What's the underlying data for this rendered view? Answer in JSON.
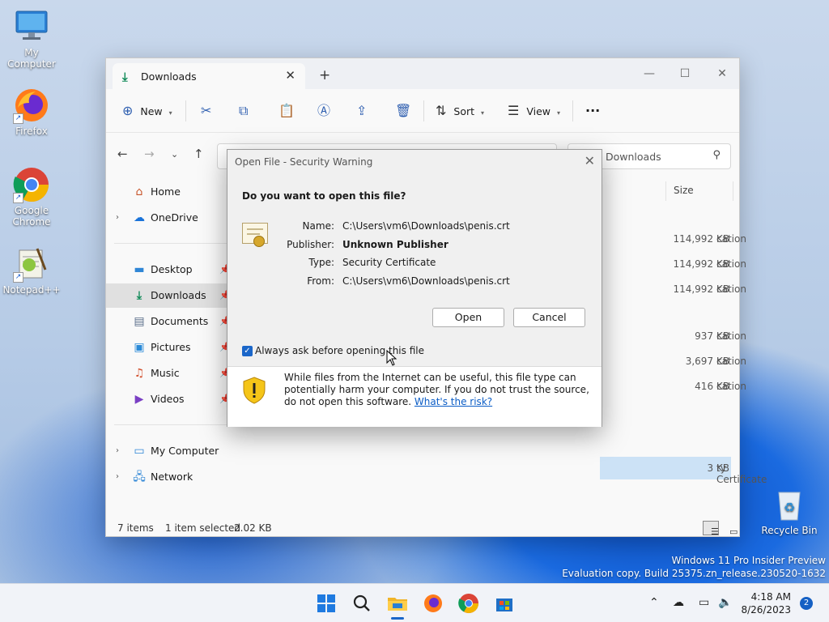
{
  "desktop": {
    "icons": [
      {
        "label": "My Computer"
      },
      {
        "label": "Firefox"
      },
      {
        "label": "Google Chrome"
      },
      {
        "label": "Notepad++"
      },
      {
        "label": "Recycle Bin"
      }
    ],
    "watermark": {
      "line1": "Windows 11 Pro Insider Preview",
      "line2": "Evaluation copy. Build 25375.zn_release.230520-1632"
    }
  },
  "explorer": {
    "tab_title": "Downloads",
    "toolbar": {
      "new_label": "New",
      "sort_label": "Sort",
      "view_label": "View"
    },
    "search_placeholder": "Downloads",
    "sidebar": {
      "items": [
        {
          "label": "Home",
          "icon": "home-icon"
        },
        {
          "label": "OneDrive",
          "icon": "cloud-icon"
        },
        {
          "label": "Desktop",
          "icon": "desktop-icon"
        },
        {
          "label": "Downloads",
          "icon": "download-icon",
          "selected": true
        },
        {
          "label": "Documents",
          "icon": "document-icon"
        },
        {
          "label": "Pictures",
          "icon": "picture-icon"
        },
        {
          "label": "Music",
          "icon": "music-icon"
        },
        {
          "label": "Videos",
          "icon": "video-icon"
        },
        {
          "label": "My Computer",
          "icon": "computer-icon"
        },
        {
          "label": "Network",
          "icon": "network-icon"
        }
      ]
    },
    "columns": {
      "size": "Size"
    },
    "rows": [
      {
        "type_fragment": "cation",
        "size": "114,992 KB"
      },
      {
        "type_fragment": "cation",
        "size": "114,992 KB"
      },
      {
        "type_fragment": "cation",
        "size": "114,992 KB"
      },
      {
        "type_fragment": "cation",
        "size": "937 KB"
      },
      {
        "type_fragment": "cation",
        "size": "3,697 KB"
      },
      {
        "type_fragment": "cation",
        "size": "416 KB"
      },
      {
        "type_fragment": "ty Certificate",
        "size": "3 KB",
        "selected": true
      }
    ],
    "status": {
      "items": "7 items",
      "selection": "1 item selected",
      "selection_size": "2.02 KB"
    }
  },
  "dialog": {
    "title": "Open File - Security Warning",
    "question": "Do you want to open this file?",
    "fields": [
      {
        "label": "Name:",
        "value": "C:\\Users\\vm6\\Downloads\\penis.crt"
      },
      {
        "label": "Publisher:",
        "value": "Unknown Publisher"
      },
      {
        "label": "Type:",
        "value": "Security Certificate"
      },
      {
        "label": "From:",
        "value": "C:\\Users\\vm6\\Downloads\\penis.crt"
      }
    ],
    "open_label": "Open",
    "cancel_label": "Cancel",
    "checkbox_label": "Always ask before opening this file",
    "checkbox_checked": true,
    "warning_text": "While files from the Internet can be useful, this file type can potentially harm your computer. If you do not trust the source, do not open this software.",
    "risk_link": "What's the risk?"
  },
  "taskbar": {
    "time": "4:18 AM",
    "date": "8/26/2023",
    "notification_count": "2"
  },
  "colors": {
    "accent": "#1a66c9",
    "selection": "#cce2f6",
    "warning_shield": "#f5c518"
  }
}
